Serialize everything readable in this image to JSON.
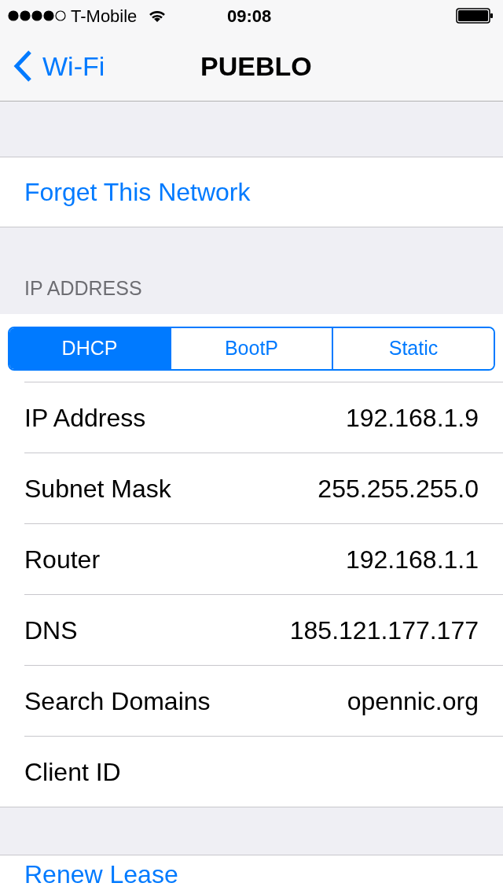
{
  "status_bar": {
    "carrier": "T-Mobile",
    "time": "09:08"
  },
  "nav": {
    "back": "Wi-Fi",
    "title": "PUEBLO"
  },
  "forget": "Forget This Network",
  "ip_section": {
    "header": "IP ADDRESS",
    "segments": [
      {
        "label": "DHCP",
        "selected": true
      },
      {
        "label": "BootP",
        "selected": false
      },
      {
        "label": "Static",
        "selected": false
      }
    ],
    "rows": [
      {
        "label": "IP Address",
        "value": "192.168.1.9"
      },
      {
        "label": "Subnet Mask",
        "value": "255.255.255.0"
      },
      {
        "label": "Router",
        "value": "192.168.1.1"
      },
      {
        "label": "DNS",
        "value": "185.121.177.177"
      },
      {
        "label": "Search Domains",
        "value": "opennic.org"
      },
      {
        "label": "Client ID"
      }
    ]
  },
  "renew": "Renew Lease"
}
